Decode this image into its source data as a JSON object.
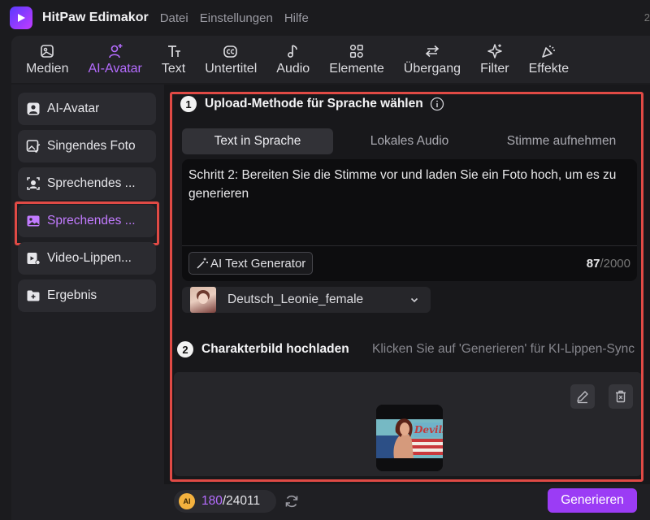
{
  "app": {
    "name": "HitPaw Edimakor",
    "menu": [
      "Datei",
      "Einstellungen",
      "Hilfe"
    ],
    "edge_text": "2"
  },
  "toolbar": {
    "items": [
      {
        "label": "Medien",
        "icon": "media-icon"
      },
      {
        "label": "AI-Avatar",
        "icon": "ai-avatar-icon",
        "active": true
      },
      {
        "label": "Text",
        "icon": "text-icon"
      },
      {
        "label": "Untertitel",
        "icon": "subtitle-icon"
      },
      {
        "label": "Audio",
        "icon": "audio-icon"
      },
      {
        "label": "Elemente",
        "icon": "elements-icon"
      },
      {
        "label": "Übergang",
        "icon": "transition-icon"
      },
      {
        "label": "Filter",
        "icon": "filter-icon"
      },
      {
        "label": "Effekte",
        "icon": "effects-icon"
      }
    ]
  },
  "sidebar": {
    "items": [
      {
        "label": "AI-Avatar",
        "icon": "avatar-icon"
      },
      {
        "label": "Singendes Foto",
        "icon": "singing-photo-icon"
      },
      {
        "label": "Sprechendes ...",
        "icon": "talking-head-icon"
      },
      {
        "label": "Sprechendes ...",
        "icon": "talking-photo-icon",
        "active": true
      },
      {
        "label": "Video-Lippen...",
        "icon": "lip-sync-icon"
      },
      {
        "label": "Ergebnis",
        "icon": "folder-icon"
      }
    ]
  },
  "step1": {
    "number": "1",
    "title": "Upload-Methode für Sprache wählen",
    "tabs": [
      "Text in Sprache",
      "Lokales Audio",
      "Stimme aufnehmen"
    ],
    "active_tab": 0,
    "text": "Schritt 2: Bereiten Sie die Stimme vor und laden Sie ein Foto hoch, um es zu generieren",
    "ai_generator_label": "AI Text Generator",
    "char_count": "87",
    "char_max": "/2000",
    "voice": "Deutsch_Leonie_female"
  },
  "step2": {
    "number": "2",
    "title": "Charakterbild hochladen",
    "hint": "Klicken Sie auf 'Generieren' für KI-Lippen-Sync",
    "image_text": "Devils"
  },
  "footer": {
    "badge": "AI",
    "credits_used": "180",
    "credits_total": "/24011",
    "generate_label": "Generieren"
  },
  "colors": {
    "accent": "#9b3cf5",
    "active_text": "#b56cff",
    "highlight_frame": "#e04a45",
    "background": "#18181b"
  }
}
